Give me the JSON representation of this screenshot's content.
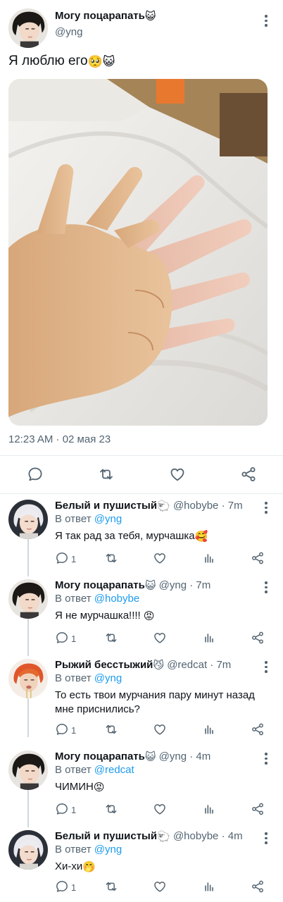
{
  "main_tweet": {
    "display_name": "Могу поцарапать",
    "name_emoji": "😺",
    "handle": "@yng",
    "text": "Я люблю его",
    "text_emojis": "🥺😺",
    "timestamp": "12:23 AM · 02 мая 23",
    "actions": [
      "reply-icon",
      "retweet-icon",
      "like-icon",
      "share-icon"
    ]
  },
  "replies": [
    {
      "display_name": "Белый и пушистый",
      "name_emoji": "🐑",
      "handle": "@hobybe",
      "time": "· 7m",
      "in_reply_label": "В ответ",
      "in_reply_to": "@yng",
      "text": "Я так рад за тебя, мурчашка",
      "text_emoji": "🥰",
      "reply_count": "1"
    },
    {
      "display_name": "Могу поцарапать",
      "name_emoji": "😺",
      "handle": "@yng",
      "time": "· 7m",
      "in_reply_label": "В ответ",
      "in_reply_to": "@hobybe",
      "text": "Я не мурчашка!!!! ",
      "text_emoji": "😡",
      "reply_count": "1"
    },
    {
      "display_name": "Рыжий бесстыжий",
      "name_emoji": "😼",
      "handle": "@redcat",
      "time": "· 7m",
      "in_reply_label": "В ответ",
      "in_reply_to": "@yng",
      "text": "То есть твои мурчания пару минут назад мне приснились?",
      "text_emoji": "",
      "reply_count": "1"
    },
    {
      "display_name": "Могу поцарапать",
      "name_emoji": "😺",
      "handle": "@yng",
      "time": "· 4m",
      "in_reply_label": "В ответ",
      "in_reply_to": "@redcat",
      "text": "ЧИМИН",
      "text_emoji": "😡",
      "reply_count": "1"
    },
    {
      "display_name": "Белый и пушистый",
      "name_emoji": "🐑",
      "handle": "@hobybe",
      "time": "· 4m",
      "in_reply_label": "В ответ",
      "in_reply_to": "@yng",
      "text": "Хи-хи",
      "text_emoji": "🤭",
      "reply_count": "1"
    }
  ],
  "colors": {
    "link": "#1d9bf0",
    "secondary_text": "#536471",
    "icon": "#536471",
    "primary_text": "#0f1419"
  }
}
